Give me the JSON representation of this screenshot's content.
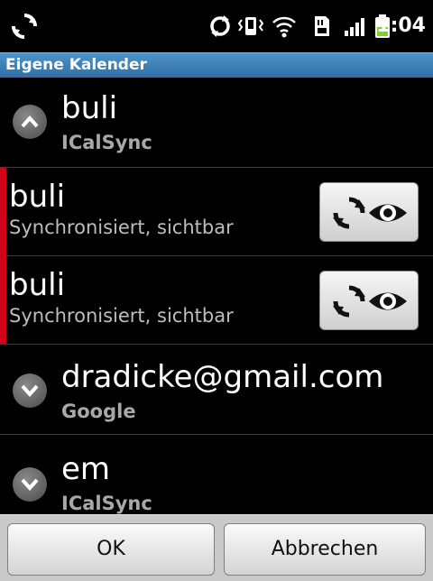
{
  "status_bar": {
    "time": "1:04",
    "icons": [
      "sync-spinner-icon",
      "sync-icon",
      "vibrate-icon",
      "wifi-icon",
      "sd-card-icon",
      "signal-icon",
      "battery-icon"
    ],
    "battery_color": "#7ed321"
  },
  "title_bar": {
    "title": "Eigene Kalender"
  },
  "list": {
    "groups": [
      {
        "title": "buli",
        "subtitle": "ICalSync",
        "expanded": true
      },
      {
        "title": "dradicke@gmail.com",
        "subtitle": "Google",
        "expanded": false
      },
      {
        "title": "em",
        "subtitle": "ICalSync",
        "expanded": false
      }
    ],
    "calendars": [
      {
        "title": "buli",
        "status": "Synchronisiert, sichtbar",
        "color": "#d0021b"
      },
      {
        "title": "buli",
        "status": "Synchronisiert, sichtbar",
        "color": "#d0021b"
      }
    ]
  },
  "buttons": {
    "ok": "OK",
    "cancel": "Abbrechen"
  }
}
